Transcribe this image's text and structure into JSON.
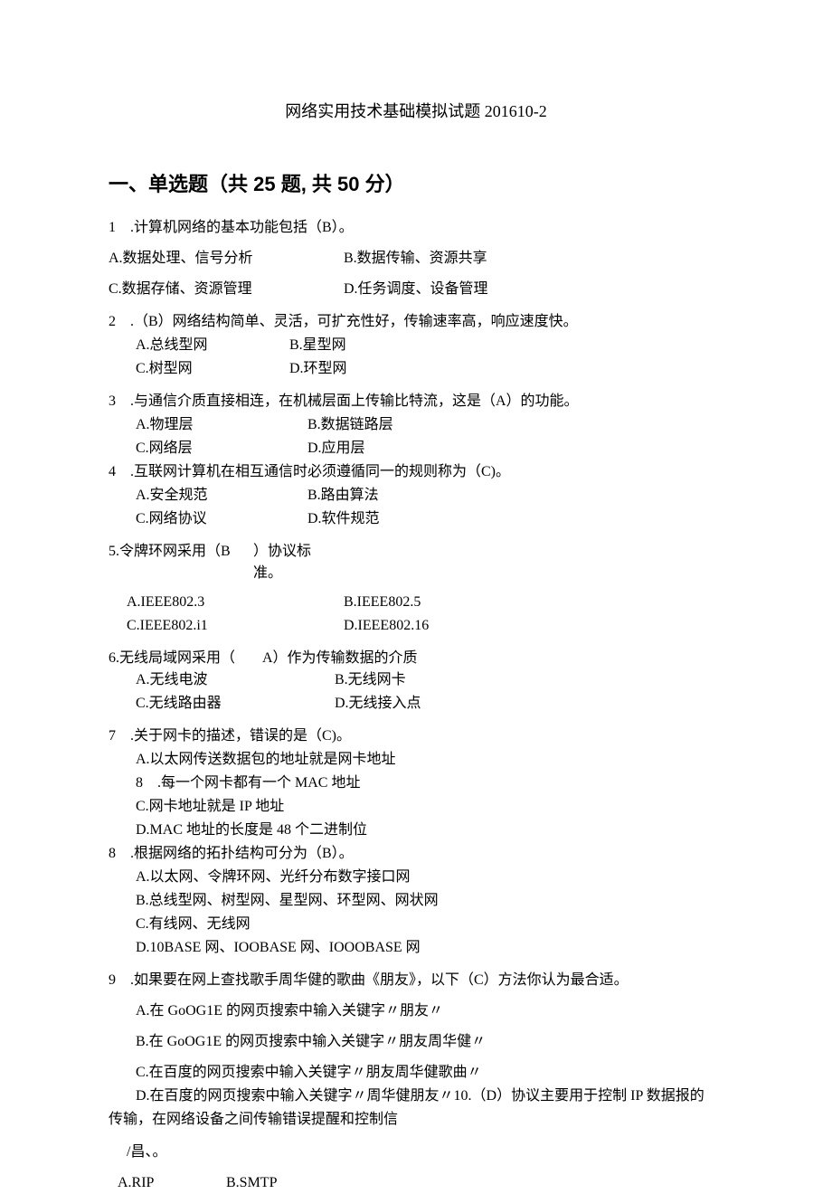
{
  "title": "网络实用技术基础模拟试题 201610-2",
  "section": "一、单选题（共 25 题, 共 50 分）",
  "q1": {
    "stem": "1　.计算机网络的基本功能包括（B）。",
    "a": "A.数据处理、信号分析",
    "b": "B.数据传输、资源共享",
    "c": "C.数据存储、资源管理",
    "d": "D.任务调度、设备管理"
  },
  "q2": {
    "stem": "2　.（B）网络结构简单、灵活，可扩充性好，传输速率高，响应速度快。",
    "a": "A.总线型网",
    "b": "B.星型网",
    "c": "C.树型网",
    "d": "D.环型网"
  },
  "q3": {
    "stem": "3　.与通信介质直接相连，在机械层面上传输比特流，这是（A）的功能。",
    "a": "A.物理层",
    "b": "B.数据链路层",
    "c": "C.网络层",
    "d": "D.应用层"
  },
  "q4": {
    "stem": "4　.互联网计算机在相互通信时必须遵循同一的规则称为（C)。",
    "a": "A.安全规范",
    "b": "B.路由算法",
    "c": "C.网络协议",
    "d": "D.软件规范"
  },
  "q5": {
    "stem_a": "5.令牌环网采用（B",
    "stem_b": "）协议标准。",
    "a": "A.IEEE802.3",
    "b": "B.IEEE802.5",
    "c": "C.IEEE802.i1",
    "d": "D.IEEE802.16"
  },
  "q6": {
    "stem_a": "6.无线局域网采用（",
    "stem_b": "A）作为传输数据的介质",
    "a": "A.无线电波",
    "b": "B.无线网卡",
    "c": "C.无线路由器",
    "d": "D.无线接入点"
  },
  "q7": {
    "stem": "7　.关于网卡的描述，错误的是（C)。",
    "a": "A.以太网传送数据包的地址就是网卡地址",
    "s8": "8　.每一个网卡都有一个 MAC 地址",
    "c": "C.网卡地址就是 IP 地址",
    "d": "D.MAC 地址的长度是 48 个二进制位"
  },
  "q8": {
    "stem": "8　.根据网络的拓扑结构可分为（B）。",
    "a": "A.以太网、令牌环网、光纤分布数字接口网",
    "b": "B.总线型网、树型网、星型网、环型网、网状网",
    "c": "C.有线网、无线网",
    "d": "D.10BASE 网、IOOBASE 网、IOOOBASE 网"
  },
  "q9": {
    "stem": "9　.如果要在网上查找歌手周华健的歌曲《朋友》，以下（C）方法你认为最合适。",
    "a": "A.在 GoOG1E 的网页搜索中输入关键字〃朋友〃",
    "b": "B.在 GoOG1E 的网页搜索中输入关键字〃朋友周华健〃",
    "c": "C.在百度的网页搜索中输入关键字〃朋友周华健歌曲〃",
    "d_and_10": "D.在百度的网页搜索中输入关键字〃周华健朋友〃10.（D）协议主要用于控制 IP 数据报的",
    "cont": "传输，在网络设备之间传输错误提醒和控制信"
  },
  "tail": "/昌、。",
  "q10opts": {
    "a": "A.RIP",
    "b": "B.SMTP"
  }
}
